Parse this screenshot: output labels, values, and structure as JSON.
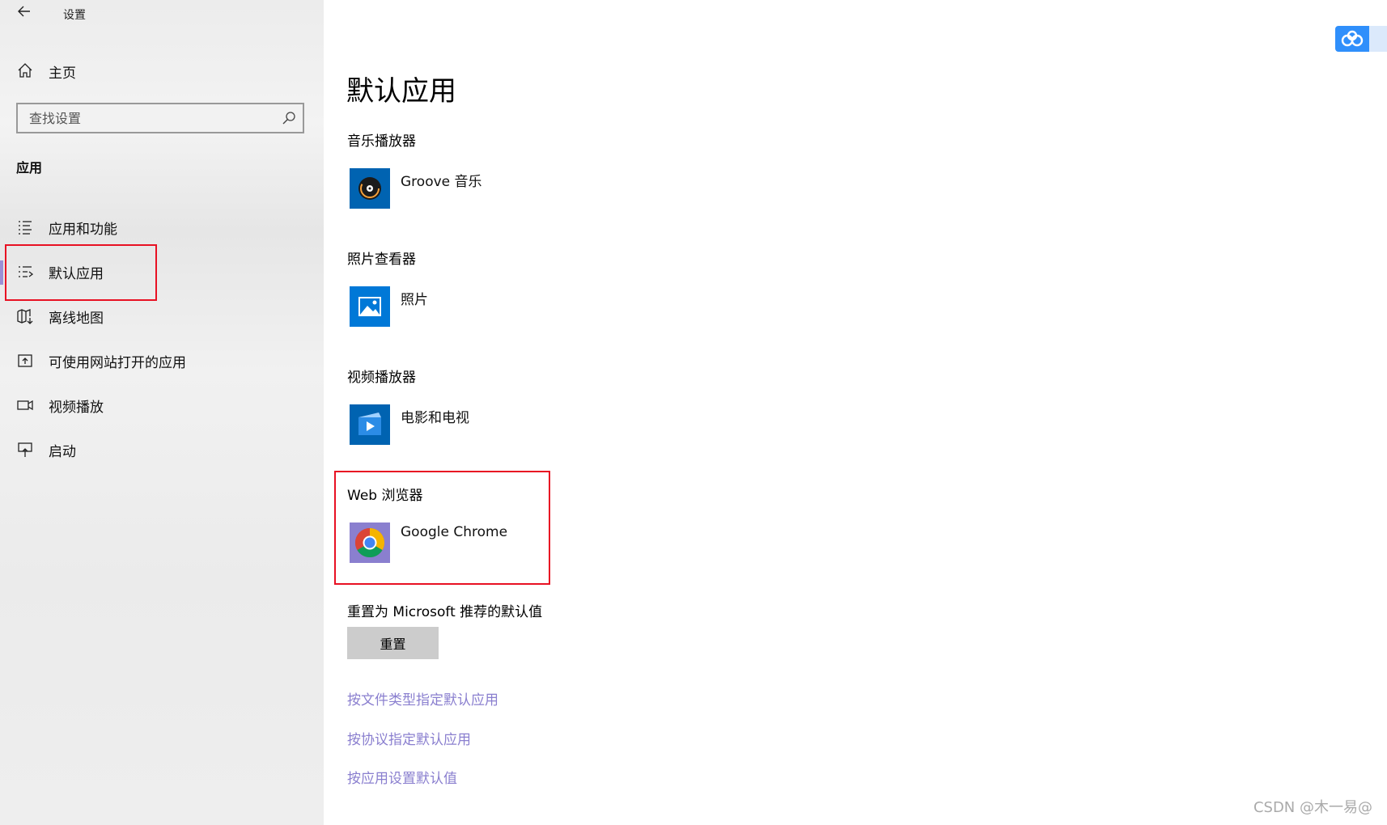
{
  "window": {
    "title": "设置",
    "back_icon": "arrow-left-icon"
  },
  "sidebar": {
    "home_label": "主页",
    "search_placeholder": "查找设置",
    "section_title": "应用",
    "items": [
      {
        "label": "应用和功能",
        "icon": "list-icon"
      },
      {
        "label": "默认应用",
        "icon": "list-default-icon",
        "selected": true
      },
      {
        "label": "离线地图",
        "icon": "map-download-icon"
      },
      {
        "label": "可使用网站打开的应用",
        "icon": "open-in-app-icon"
      },
      {
        "label": "视频播放",
        "icon": "video-icon"
      },
      {
        "label": "启动",
        "icon": "startup-icon"
      }
    ]
  },
  "main": {
    "title": "默认应用",
    "groups": [
      {
        "label": "音乐播放器",
        "app": "Groove 音乐",
        "icon": "groove-music-icon"
      },
      {
        "label": "照片查看器",
        "app": "照片",
        "icon": "photos-icon"
      },
      {
        "label": "视频播放器",
        "app": "电影和电视",
        "icon": "movies-tv-icon"
      },
      {
        "label": "Web 浏览器",
        "app": "Google Chrome",
        "icon": "chrome-icon"
      }
    ],
    "reset_label": "重置为 Microsoft 推荐的默认值",
    "reset_button": "重置",
    "links": [
      "按文件类型指定默认应用",
      "按协议指定默认应用",
      "按应用设置默认值"
    ]
  },
  "colors": {
    "accent_blue": "#0063b1",
    "link": "#8a7fcf",
    "highlight": "#e81123",
    "button_bg": "#cccccc"
  },
  "watermark": "CSDN @木一易@"
}
